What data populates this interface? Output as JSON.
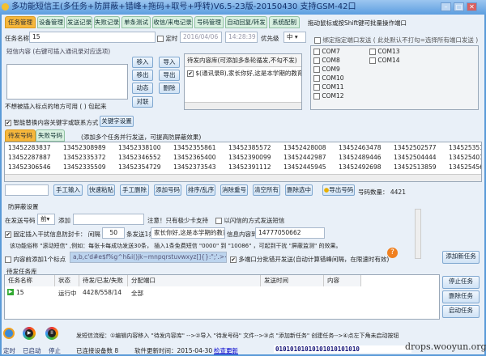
{
  "window": {
    "title": "多功能短信王(多任务+防屏蔽+错峰+拖码+取号+呼转)V6.5-23版-20150430 支持GSM-42口",
    "minimize": "–",
    "maximize": "□",
    "close": "✕"
  },
  "tabs": [
    "任务管理",
    "设备管理",
    "发送记录",
    "失败记录",
    "单条测试",
    "收信/来电记录",
    "号码管理",
    "自动回复/转发",
    "系统配制"
  ],
  "tab_hint": "拖动鼠标或按Shift键可批量操作端口",
  "task": {
    "name_label": "任务名称",
    "name_value": "15",
    "timer_label": "定时",
    "date": "2016/04/06",
    "time": "14:28:39",
    "priority_label": "优先级",
    "priority": "中"
  },
  "sms": {
    "label": "短信内容 (右键可插入通讯录对应选项)",
    "hint": "不想被插入标点的地方可用 ( ) 包起来",
    "buttons": [
      "移入",
      "导入",
      "移出",
      "导出",
      "动态",
      "删除",
      "对联"
    ],
    "pending_header": "待发内容库(可添加多条轮循发,不勾不发)",
    "pending_items": [
      "$(通讯录B),家长你好,这是本学期的教育..."
    ]
  },
  "ports": {
    "bind_label": "绑定指定端口发送 ( 此处默认不打勾=选择所有端口发送 )",
    "col1": [
      "COM7",
      "COM8",
      "COM9",
      "COM10",
      "COM11",
      "COM12"
    ],
    "col2": [
      "COM13",
      "COM14"
    ]
  },
  "smart": {
    "label": "智能替换内容关键字或联系方式",
    "button": "关键字设置"
  },
  "numbers": {
    "subtabs": [
      "待发号码",
      "失败号码"
    ],
    "hint": "(添加多个任务并行发送，可提高防屏蔽效果)",
    "rows": [
      [
        "13452283837",
        "13452308989",
        "13452338100",
        "13452355861",
        "13452385572",
        "13452428008",
        "13452463478",
        "13452502577",
        "13452535151"
      ],
      [
        "13452287887",
        "13452335372",
        "13452346552",
        "13452365400",
        "13452390099",
        "13452442987",
        "13452489446",
        "13452504444",
        "13452540133"
      ],
      [
        "13452306546",
        "13452335509",
        "13452354729",
        "13452373543",
        "13452391112",
        "13452445945",
        "13452492698",
        "13452513859",
        "13452545681"
      ]
    ],
    "buttons": [
      "手工输入",
      "快速粘贴",
      "手工删除",
      "添加号码",
      "排序/乱序",
      "消除重号",
      "清空所有",
      "删除选中"
    ],
    "export": "导出号码",
    "count_label": "号码数量：",
    "count": "4421"
  },
  "anti": {
    "title": "防屏蔽设置",
    "prefix_label": "在发送号码",
    "position": "前",
    "add_label": "添加",
    "note": "注意！只有极少卡支持",
    "flash_label": "以闪信的方式发送短信",
    "fixed_label": "固定插入干扰信息防封卡：  间隔",
    "interval": "50",
    "per_label": "条发送1条",
    "interfere_text": "家长你好,这是本学期的教育",
    "to_label": "信息内容到",
    "to_number": "14777050662",
    "desc": "该功能俗称 \"滚动短信\" ,例如：每张卡每成功发送30条， 插入1条免费短信 \"0000\" 到 \"10086\" ，可起到干扰 \"屏蔽监测\" 的效果。",
    "punct_label": "内容前添加1个标点",
    "punct_chars": "a,b,c'd#e$f%g^h&i()jk~mnpqrstuvwxyz[]{}:\";'.>< ",
    "multi_label": "多端口分批错开发送(自动计算错峰间隔，在限速时有效)",
    "add_task": "添加新任务"
  },
  "tasks": {
    "title": "待发任务库",
    "columns": [
      "任务名称",
      "状态",
      "待发/已发/失败",
      "分配端口",
      "发送时间",
      "内容"
    ],
    "rows": [
      {
        "name": "15",
        "status": "运行中",
        "counts": "4428/558/14",
        "ports": "全部",
        "time": "",
        "content": ""
      }
    ],
    "buttons": [
      "停止任务",
      "删除任务",
      "启动任务"
    ]
  },
  "footer": {
    "icons": [
      {
        "label": "定时",
        "icon": "alarm-clock-icon"
      },
      {
        "label": "已启动",
        "icon": "play-icon"
      },
      {
        "label": "停止",
        "icon": "pause-icon"
      }
    ],
    "flow": "发短信流程：①编辑内容移入 \"待发内容库\" -->②导入 \"待发号码\" 文件-->③点 \"添加新任务\" 创建任务-->④点左下角未启动按钮",
    "devices": "已连接设备数 8",
    "update_label": "软件更新时间：2015-04-30",
    "check": "检查更新",
    "binary": "01010101010101010101010",
    "watermark": "drops.wooyun.org"
  }
}
